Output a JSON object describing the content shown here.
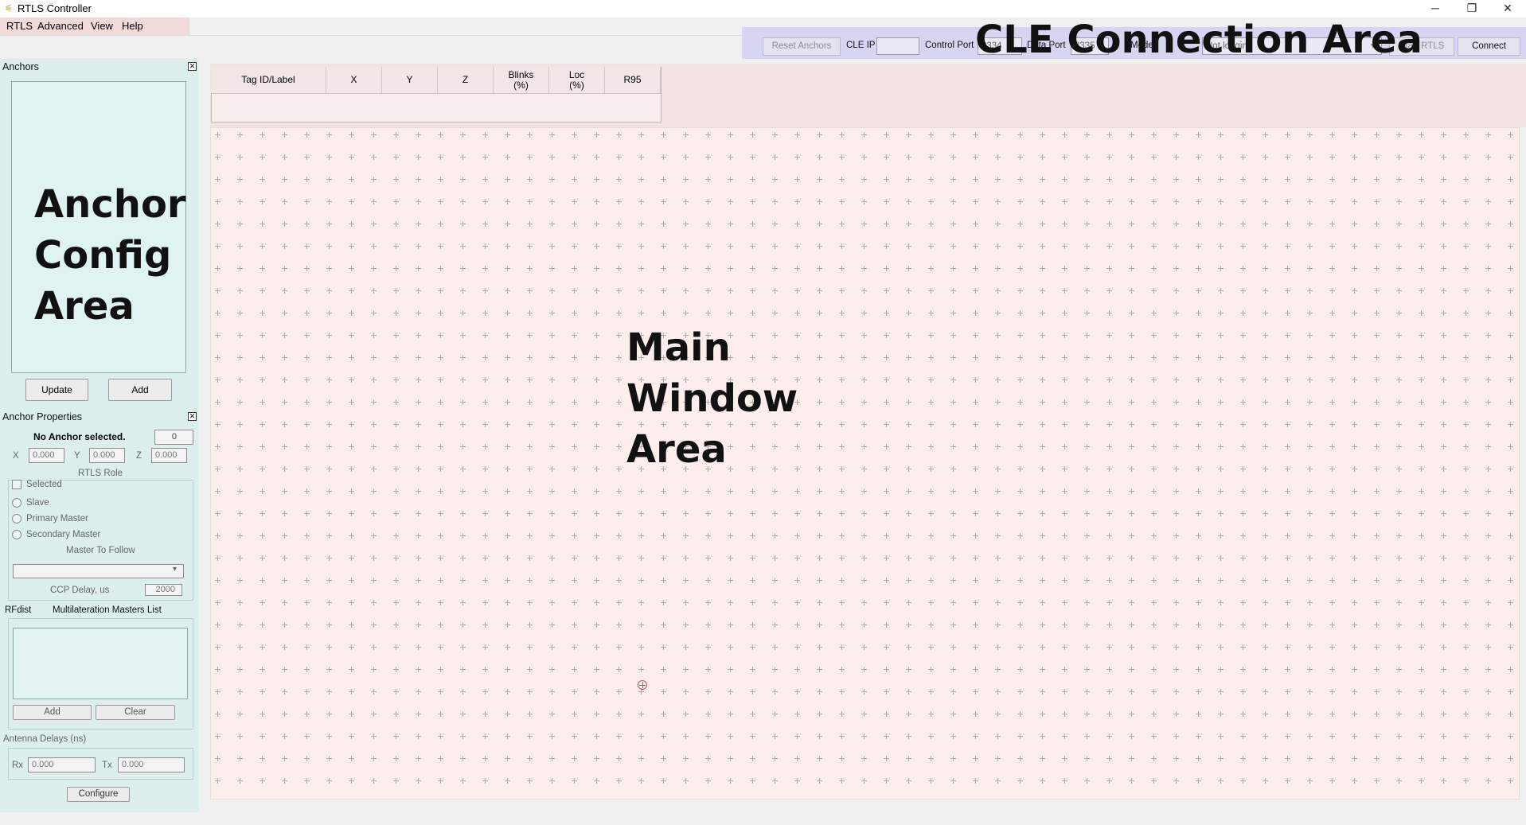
{
  "window": {
    "title": "RTLS Controller",
    "icon": "rtls-app-icon",
    "minimize": "─",
    "maximize": "❐",
    "close": "✕"
  },
  "menubar": {
    "items": [
      {
        "label": "RTLS"
      },
      {
        "label": "Advanced"
      },
      {
        "label": "View"
      },
      {
        "label": "Help"
      }
    ]
  },
  "toolbar": {
    "reset_anchors": "Reset Anchors",
    "cle_ip_label": "CLE IP",
    "cle_ip_value": "",
    "control_port_label": "Control Port",
    "control_port_value": "3334",
    "data_port_label": "Data Port",
    "data_port_value": "3335",
    "mode_label": "Mode",
    "mode_value": "Not logging",
    "start_rtls": "Start RTLS",
    "connect": "Connect",
    "overlay": "CLE Connection Area"
  },
  "anchors_panel": {
    "title": "Anchors",
    "overlay": "Anchor\nConfig\nArea",
    "update": "Update",
    "add": "Add"
  },
  "anchor_properties": {
    "title": "Anchor Properties",
    "status": "No Anchor selected.",
    "id_value": "0",
    "x_label": "X",
    "x_value": "0.000",
    "y_label": "Y",
    "y_value": "0.000",
    "z_label": "Z",
    "z_value": "0.000",
    "rtls_role": "RTLS Role",
    "selected": "Selected",
    "slave": "Slave",
    "primary_master": "Primary Master",
    "secondary_master": "Secondary Master",
    "master_to_follow": "Master To Follow",
    "master_value": "",
    "ccp_delay_label": "CCP Delay, us",
    "ccp_delay_value": "2000",
    "rfdist": "RFdist",
    "multilat_list": "Multilateration Masters List",
    "add": "Add",
    "clear": "Clear",
    "antenna_delays": "Antenna Delays (ns)",
    "rx_label": "Rx",
    "rx_value": "0.000",
    "tx_label": "Tx",
    "tx_value": "0.000",
    "configure": "Configure"
  },
  "tag_table": {
    "columns": [
      "Tag ID/Label",
      "X",
      "Y",
      "Z",
      "Blinks\n(%)",
      "Loc\n(%)",
      "R95"
    ]
  },
  "main": {
    "overlay": "Main\nWindow\nArea"
  },
  "colors": {
    "anchor_area": "#dcefed",
    "main_area": "#fdeded",
    "cle_area": "#d6d6f2",
    "menu_area": "#f3dada",
    "origin_marker": "#d05050"
  }
}
